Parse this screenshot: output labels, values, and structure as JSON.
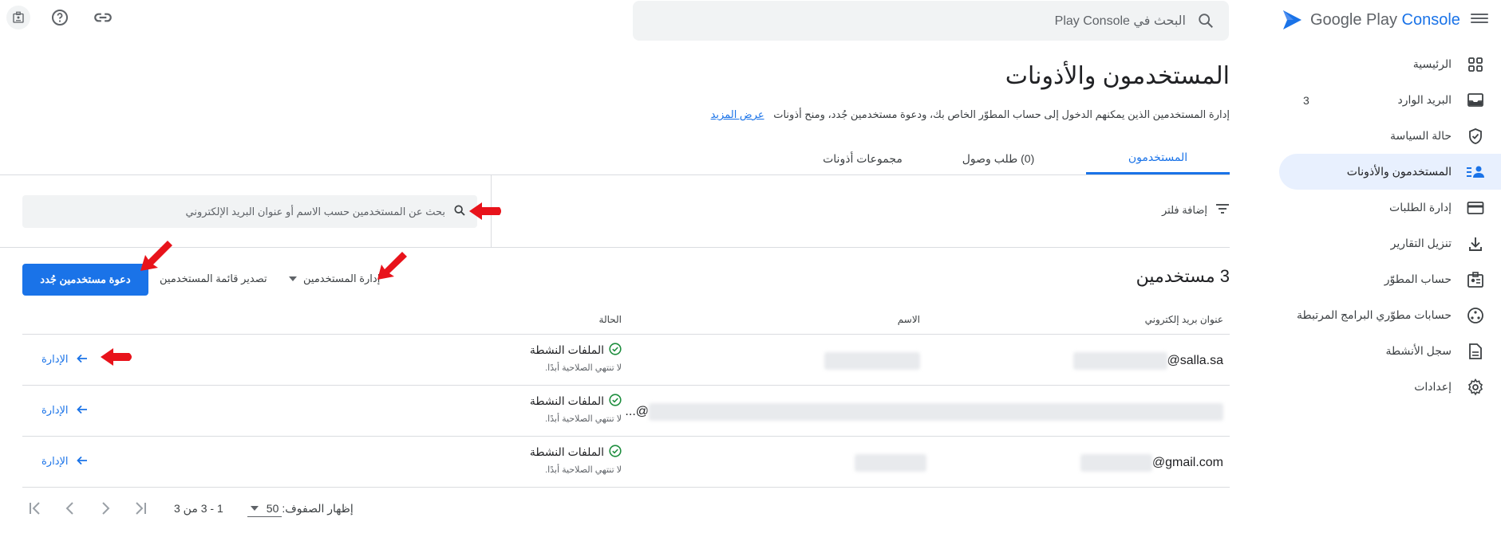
{
  "app": {
    "logo_prefix": "Google Play",
    "logo_suffix": "Console",
    "search_placeholder": "البحث في Play Console"
  },
  "colors": {
    "accent": "#1a73e8",
    "active_nav_bg": "#e8f0fe",
    "success": "#1e8e3e",
    "annotation_arrow": "#e8131b"
  },
  "sidebar": {
    "items": [
      {
        "label": "الرئيسية",
        "icon": "grid-icon"
      },
      {
        "label": "البريد الوارد",
        "icon": "inbox-icon",
        "count": "3"
      },
      {
        "label": "حالة السياسة",
        "icon": "shield-icon"
      },
      {
        "label": "المستخدمون والأذونات",
        "icon": "people-list-icon",
        "active": true
      },
      {
        "label": "إدارة الطلبات",
        "icon": "credit-card-icon"
      },
      {
        "label": "تنزيل التقارير",
        "icon": "download-icon"
      },
      {
        "label": "حساب المطوّر",
        "icon": "badge-icon"
      },
      {
        "label": "حسابات مطوّري البرامج المرتبطة",
        "icon": "linked-accounts-icon"
      },
      {
        "label": "سجل الأنشطة",
        "icon": "document-icon"
      },
      {
        "label": "إعدادات",
        "icon": "gear-icon"
      }
    ]
  },
  "page": {
    "title": "المستخدمون والأذونات",
    "description": "إدارة المستخدمين الذين يمكنهم الدخول إلى حساب المطوّر الخاص بك، ودعوة مستخدمين جُدد، ومنح أذونات",
    "learn_more": "عرض المزيد"
  },
  "tabs": [
    {
      "label": "المستخدمون",
      "active": true
    },
    {
      "label": "(0) طلب وصول"
    },
    {
      "label": "مجموعات أذونات"
    }
  ],
  "filters": {
    "add_filter": "إضافة فلتر",
    "search_placeholder": "بحث عن المستخدمين حسب الاسم أو عنوان البريد الإلكتروني"
  },
  "toolbar": {
    "count_title": "3 مستخدمين",
    "manage_users": "إدارة المستخدمين",
    "export": "تصدير قائمة المستخدمين",
    "invite": "دعوة مستخدمين جُدد"
  },
  "table": {
    "headers": {
      "email": "عنوان بريد إلكتروني",
      "name": "الاسم",
      "status": "الحالة"
    },
    "rows": [
      {
        "email": "@salla.sa",
        "status": "الملفات النشطة",
        "expiry": "لا تنتهي الصلاحية أبدًا.",
        "action": "الإدارة"
      },
      {
        "email": "...@",
        "status": "الملفات النشطة",
        "expiry": "لا تنتهي الصلاحية أبدًا.",
        "action": "الإدارة"
      },
      {
        "email": "@gmail.com",
        "status": "الملفات النشطة",
        "expiry": "لا تنتهي الصلاحية أبدًا.",
        "action": "الإدارة"
      }
    ]
  },
  "pagination": {
    "rows_label": "إظهار الصفوف:",
    "rows_value": "50",
    "range": "1 - 3 من 3"
  }
}
